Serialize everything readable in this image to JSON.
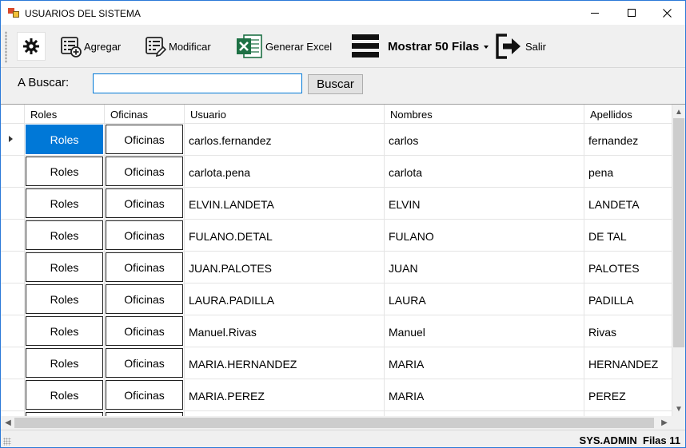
{
  "window": {
    "title": "USUARIOS DEL SISTEMA",
    "icons": {
      "app": "app-icon",
      "minimize": "minimize-icon",
      "maximize": "maximize-icon",
      "close": "close-icon"
    }
  },
  "toolbar": {
    "settings_icon": "gear-icon",
    "add_label": "Agregar",
    "modify_label": "Modificar",
    "excel_label": "Generar Excel",
    "rows_label": "Mostrar 50 Filas",
    "exit_label": "Salir"
  },
  "search": {
    "label": "A Buscar:",
    "value": "",
    "button_label": "Buscar"
  },
  "grid": {
    "columns": [
      "Roles",
      "Oficinas",
      "Usuario",
      "Nombres",
      "Apellidos"
    ],
    "rows": [
      {
        "roles": "Roles",
        "oficinas": "Oficinas",
        "usuario": "carlos.fernandez",
        "nombres": "carlos",
        "apellidos": "fernandez",
        "selected": true
      },
      {
        "roles": "Roles",
        "oficinas": "Oficinas",
        "usuario": "carlota.pena",
        "nombres": "carlota",
        "apellidos": "pena"
      },
      {
        "roles": "Roles",
        "oficinas": "Oficinas",
        "usuario": "ELVIN.LANDETA",
        "nombres": "ELVIN",
        "apellidos": "LANDETA"
      },
      {
        "roles": "Roles",
        "oficinas": "Oficinas",
        "usuario": "FULANO.DETAL",
        "nombres": "FULANO",
        "apellidos": "DE TAL"
      },
      {
        "roles": "Roles",
        "oficinas": "Oficinas",
        "usuario": "JUAN.PALOTES",
        "nombres": "JUAN",
        "apellidos": "PALOTES"
      },
      {
        "roles": "Roles",
        "oficinas": "Oficinas",
        "usuario": "LAURA.PADILLA",
        "nombres": "LAURA",
        "apellidos": "PADILLA"
      },
      {
        "roles": "Roles",
        "oficinas": "Oficinas",
        "usuario": "Manuel.Rivas",
        "nombres": "Manuel",
        "apellidos": "Rivas"
      },
      {
        "roles": "Roles",
        "oficinas": "Oficinas",
        "usuario": "MARIA.HERNANDEZ",
        "nombres": "MARIA",
        "apellidos": "HERNANDEZ"
      },
      {
        "roles": "Roles",
        "oficinas": "Oficinas",
        "usuario": "MARIA.PEREZ",
        "nombres": "MARIA",
        "apellidos": "PEREZ"
      },
      {
        "roles": "",
        "oficinas": "",
        "usuario": "",
        "nombres": "",
        "apellidos": ""
      }
    ]
  },
  "status": {
    "user": "SYS.ADMIN",
    "rows_text": "Filas 11"
  },
  "colors": {
    "accent": "#0078d7",
    "window_border": "#2b79d8",
    "chrome": "#f0f0f0",
    "excel_green": "#1e7145"
  }
}
